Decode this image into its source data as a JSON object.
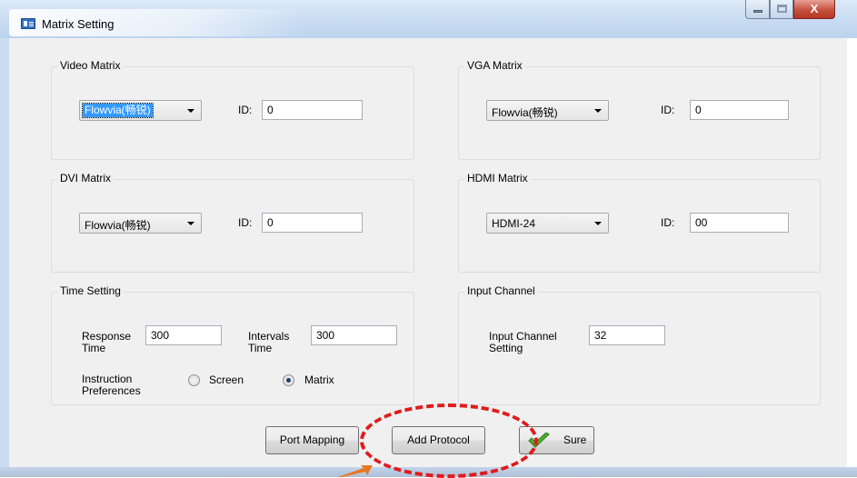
{
  "window": {
    "title": "Matrix Setting",
    "close_glyph": "X",
    "icons": {
      "app": "matrix-app-icon",
      "minimize": "minimize-icon",
      "maximize": "maximize-icon",
      "close": "close-icon"
    }
  },
  "video_matrix": {
    "title": "Video Matrix",
    "selected": "Flowvia(畅锐)",
    "id_label": "ID:",
    "id_value": "0"
  },
  "vga_matrix": {
    "title": "VGA Matrix",
    "selected": "Flowvia(畅锐)",
    "id_label": "ID:",
    "id_value": "0"
  },
  "dvi_matrix": {
    "title": "DVI Matrix",
    "selected": "Flowvia(畅锐)",
    "id_label": "ID:",
    "id_value": "0"
  },
  "hdmi_matrix": {
    "title": "HDMI Matrix",
    "selected": "HDMI-24",
    "id_label": "ID:",
    "id_value": "00"
  },
  "time_setting": {
    "title": "Time Setting",
    "response_label_1": "Response",
    "response_label_2": "Time",
    "response_value": "300",
    "intervals_label_1": "Intervals",
    "intervals_label_2": "Time",
    "intervals_value": "300",
    "instruction_label_1": "Instruction",
    "instruction_label_2": "Preferences",
    "option_screen": "Screen",
    "option_matrix": "Matrix",
    "selected_option": "Matrix"
  },
  "input_channel": {
    "title": "Input Channel",
    "setting_label_1": "Input Channel",
    "setting_label_2": "Setting",
    "value": "32"
  },
  "buttons": {
    "port_mapping": "Port Mapping",
    "add_protocol": "Add Protocol",
    "sure": "Sure",
    "sure_icon": "green-checkmark-icon"
  },
  "colors": {
    "annotation": "#e01b1b",
    "arrow": "#e87722",
    "selection": "#3399ff",
    "check": "#4caf2e"
  }
}
